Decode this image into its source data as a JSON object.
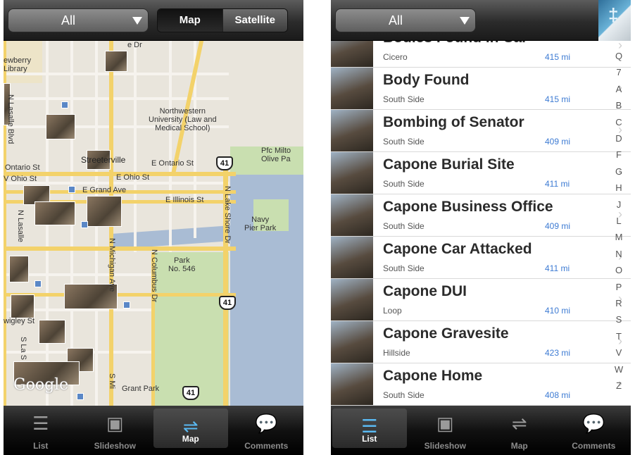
{
  "left_screen": {
    "filter": {
      "value": "All"
    },
    "segment": {
      "map": "Map",
      "satellite": "Satellite",
      "selected": "Map"
    },
    "map": {
      "labels": {
        "newberry_library": "ewberry\nLibrary",
        "northwestern": "Northwestern\nUniversity (Law and\nMedical School)",
        "streeterville": "Streeterville",
        "e_ontario": "E Ontario St",
        "ontario": "Ontario St",
        "w_ohio": "V Ohio St",
        "e_ohio": "E Ohio St",
        "e_grand": "E Grand Ave",
        "e_illinois": "E Illinois St",
        "pfc": "Pfc Milto\nOlive Pa",
        "navy_pier": "Navy\nPier Park",
        "park546": "Park\nNo. 546",
        "grant_park": "Grant Park",
        "n_lasalle_blvd": "N Lasalle Blvd",
        "n_lasalle": "N Lasalle",
        "n_michigan": "N Michigan Ave",
        "n_columbus": "N Columbus Dr",
        "n_lake_shore": "N Lake Shore Dr",
        "s_michigan": "S Mi",
        "s_la": "S La S",
        "e_dr": "e Dr",
        "wrigley": "wigley St",
        "google": "Google",
        "hwy41a": "41",
        "hwy41b": "41",
        "hwy41c": "41"
      }
    },
    "tabs": [
      {
        "label": "List",
        "icon": "list-icon"
      },
      {
        "label": "Slideshow",
        "icon": "slideshow-icon"
      },
      {
        "label": "Map",
        "icon": "signpost-icon"
      },
      {
        "label": "Comments",
        "icon": "speech-bubble-icon"
      }
    ],
    "active_tab": "Map"
  },
  "right_screen": {
    "filter": {
      "value": "All"
    },
    "rows": [
      {
        "title": "Bodies Found in Car",
        "area": "Cicero",
        "distance": "415 mi"
      },
      {
        "title": "Body Found",
        "area": "South Side",
        "distance": "415 mi"
      },
      {
        "title": "Bombing of Senator",
        "area": "South Side",
        "distance": "409 mi"
      },
      {
        "title": "Capone Burial Site",
        "area": "South Side",
        "distance": "411 mi"
      },
      {
        "title": "Capone Business Office",
        "area": "South Side",
        "distance": "409 mi"
      },
      {
        "title": "Capone Car Attacked",
        "area": "South Side",
        "distance": "411 mi"
      },
      {
        "title": "Capone DUI",
        "area": "Loop",
        "distance": "410 mi"
      },
      {
        "title": "Capone Gravesite",
        "area": "Hillside",
        "distance": "423 mi"
      },
      {
        "title": "Capone Home",
        "area": "South Side",
        "distance": "408 mi"
      }
    ],
    "index": [
      "Q",
      "7",
      "A",
      "B",
      "C",
      "D",
      "F",
      "G",
      "H",
      "J",
      "L",
      "M",
      "N",
      "O",
      "P",
      "R",
      "S",
      "T",
      "V",
      "W",
      "Z"
    ],
    "tabs": [
      {
        "label": "List",
        "icon": "list-icon"
      },
      {
        "label": "Slideshow",
        "icon": "slideshow-icon"
      },
      {
        "label": "Map",
        "icon": "signpost-icon"
      },
      {
        "label": "Comments",
        "icon": "speech-bubble-icon"
      }
    ],
    "active_tab": "List"
  },
  "colors": {
    "accent": "#5ab9f2",
    "distance": "#3d7bd3",
    "water": "#a9bcd4",
    "park": "#c9dfb0"
  }
}
